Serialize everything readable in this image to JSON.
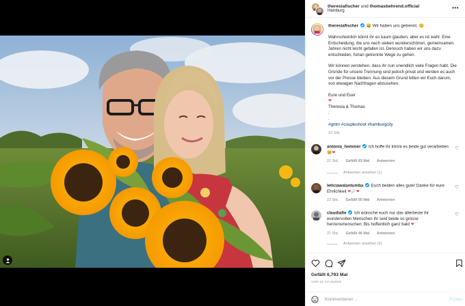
{
  "header": {
    "user1": "theresiafischer",
    "joiner": "und",
    "user2": "thomasbehrend.official",
    "location": "Hamburg",
    "more_icon": "more-horizontal-icon"
  },
  "caption": {
    "username": "theresiafischer",
    "headline": "Wir haben uns getrennt.",
    "para1": "Wahrscheinlich könnt ihr es kaum glauben, aber es ist wahr. Eine Entscheidung, die uns nach sieben wunderschönen, gemeinsamen Jahren nicht leicht gefallen ist. Dennoch haben wir uns dazu entschieden, fortan getrennte Wege zu gehen.",
    "para2": "Wir können verstehen, dass ihr nun unendlich viele Fragen habt. Die Gründe für unsere Trennung sind jedoch privat und werden es auch vor der Presse bleiben. Aus diesem Grund bitten wir Euch darum, von etwaigen Nachfragen abzusehen.",
    "sign1": "Eure und Euer",
    "sign2": "Theresia & Thomas",
    "dot1": ".",
    "dot2": ".",
    "hashtags": "#gntm #coupleshoot #hamburgcity",
    "time": "22 Std."
  },
  "comments": [
    {
      "username": "antonia_hemmer",
      "text": "ich hoffe ihr könnt es beide gut verarbeiten",
      "time": "22 Std.",
      "likes": "83 Mal",
      "gefallt": "Gefällt",
      "reply": "Antworten",
      "view_replies": "Antworten ansehen (1)"
    },
    {
      "username": "leticiawalantumba",
      "text": "Euch beiden alles gute! Danke für eure Ehrlichkeit",
      "time": "22 Std.",
      "likes": "55 Mal",
      "gefallt": "Gefällt",
      "reply": "Antworten"
    },
    {
      "username": "claudiafie",
      "text": "Ich wünsche euch nur das allerbeste ihr wundervollen Menschen ihr seid beide so grosse herzensmenschen. Bis hoffentlich ganz bald",
      "time": "21 Std.",
      "likes": "46 Mal",
      "gefallt": "Gefällt",
      "reply": "Antworten",
      "view_replies": "Antworten ansehen (2)"
    }
  ],
  "actions": {
    "likes": "Gefällt 6,793 Mal",
    "ago": "VOR 22 STUNDEN",
    "comment_placeholder": "Kommentieren ...",
    "post_label": "Posten"
  },
  "colors": {
    "verified": "#0095f6",
    "hashtag": "#00376b",
    "heart": "#ed4956",
    "post_disabled": "#b2dffc"
  }
}
